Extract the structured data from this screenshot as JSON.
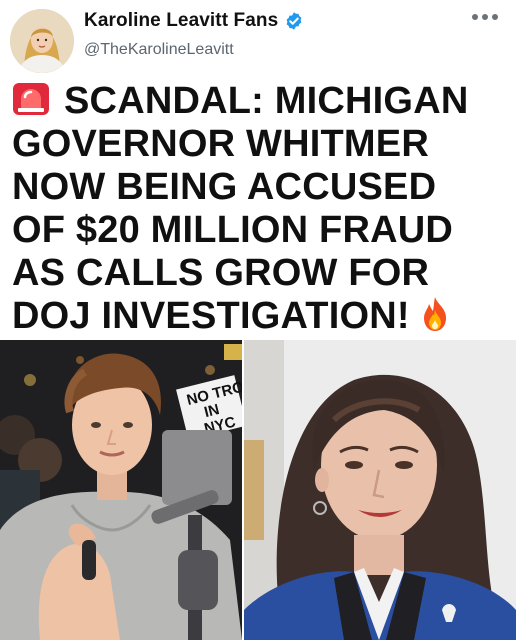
{
  "post": {
    "author_name": "Karoline Leavitt Fans",
    "handle": "@TheKarolineLeavitt",
    "verified_color": "#1d9bf0",
    "icons": [
      "avatar-photo",
      "verified-badge-icon",
      "more-options-icon",
      "siren-emoji",
      "fire-emoji"
    ]
  },
  "headline": {
    "lines": [
      "SCANDAL: MICHIGAN",
      "GOVERNOR WHITMER",
      "NOW BEING ACCUSED",
      "OF $20 MILLION FRAUD",
      "AS CALLS GROW FOR",
      "DOJ INVESTIGATION!"
    ]
  },
  "images": {
    "left_sign_text": [
      "NO TRO",
      "IN",
      "NYC"
    ]
  }
}
